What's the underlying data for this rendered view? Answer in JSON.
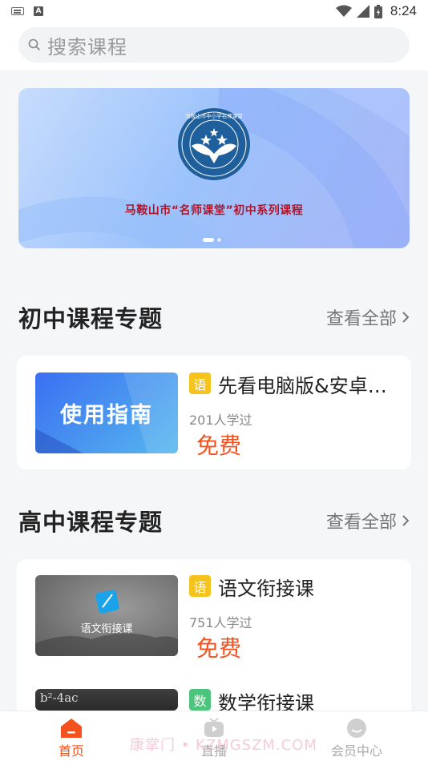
{
  "status_bar": {
    "time": "8:24",
    "icons": [
      "keyboard-icon",
      "a-notification-icon",
      "wifi-icon",
      "cellular-icon",
      "battery-icon"
    ]
  },
  "search": {
    "placeholder": "搜索课程"
  },
  "banner": {
    "title": "马鞍山市“名师课堂”初中系列课程",
    "emblem_text": "马鞍山市中小学名师课堂",
    "slide_count": 2,
    "active_slide": 1
  },
  "sections": [
    {
      "title": "初中课程专题",
      "view_all": "查看全部",
      "courses": [
        {
          "thumb_text": "使用指南",
          "subject": "语",
          "subject_color": "#f6c21c",
          "title": "先看电脑版&安卓…",
          "learners": "201人学过",
          "price": "免费"
        }
      ]
    },
    {
      "title": "高中课程专题",
      "view_all": "查看全部",
      "courses": [
        {
          "thumb_text": "语文衔接课",
          "subject": "语",
          "subject_color": "#f6c21c",
          "title": "语文衔接课",
          "learners": "751人学过",
          "price": "免费"
        },
        {
          "thumb_text": "b²-4ac",
          "subject": "数",
          "subject_color": "#4cc47b",
          "title": "数学衔接课"
        }
      ]
    }
  ],
  "tabbar": {
    "tabs": [
      {
        "label": "首页",
        "icon": "home-icon",
        "active": true
      },
      {
        "label": "直播",
        "icon": "live-icon",
        "active": false
      },
      {
        "label": "会员中心",
        "icon": "member-icon",
        "active": false
      }
    ]
  },
  "watermark": "康掌门 • KZMGSZM.COM",
  "colors": {
    "accent": "#f4511e",
    "yellow_badge": "#f6c21c",
    "green_badge": "#4cc47b",
    "banner_title": "#b0162b"
  }
}
